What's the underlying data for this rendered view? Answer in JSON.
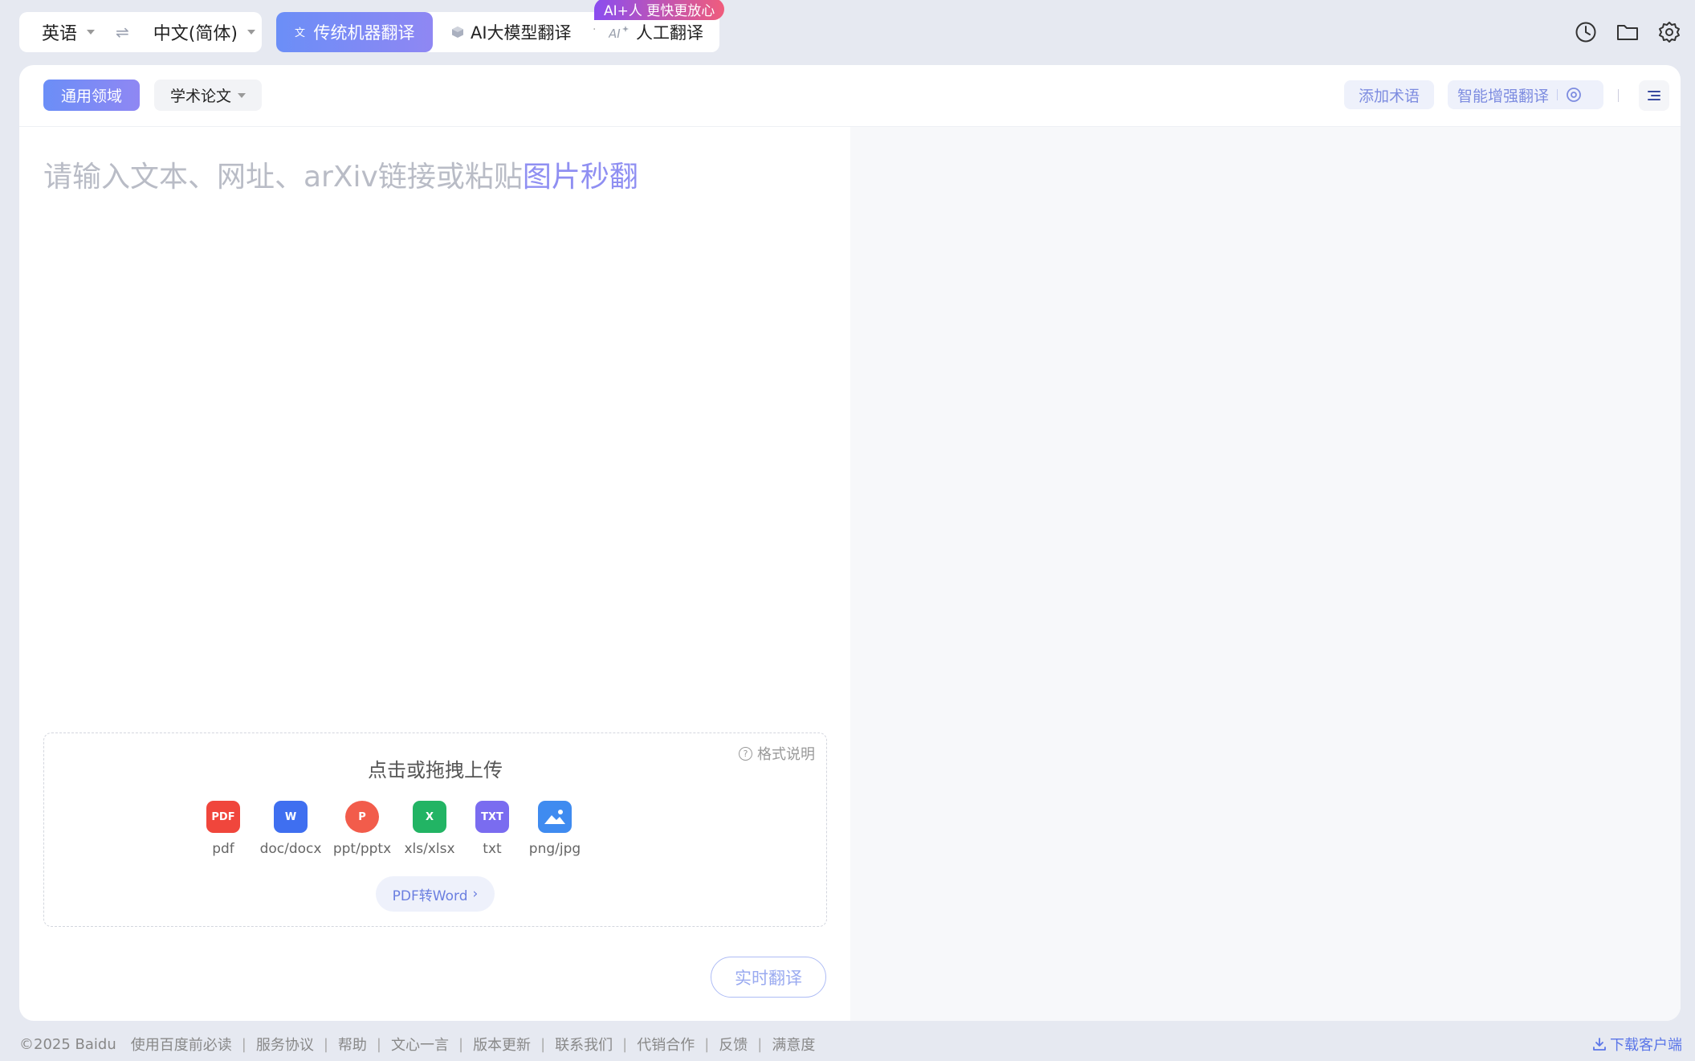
{
  "lang": {
    "source": "英语",
    "target": "中文(简体)",
    "swap_icon": "swap-icon"
  },
  "modes": {
    "traditional": "传统机器翻译",
    "ai_model": "AI大模型翻译",
    "human": "人工翻译",
    "badge": "AI+人 更快更放心"
  },
  "domains": {
    "general": "通用领域",
    "academic": "学术论文"
  },
  "tools": {
    "add_term": "添加术语",
    "enhance": "智能增强翻译"
  },
  "input": {
    "placeholder_text": "请输入文本、网址、arXiv链接或粘贴",
    "placeholder_link": "图片秒翻"
  },
  "upload": {
    "title": "点击或拖拽上传",
    "format_help": "格式说明",
    "types": [
      {
        "label": "pdf",
        "color": "#f0463c"
      },
      {
        "label": "doc/docx",
        "color": "#3f6ff0"
      },
      {
        "label": "ppt/pptx",
        "color": "#f25c4b"
      },
      {
        "label": "xls/xlsx",
        "color": "#22b464"
      },
      {
        "label": "txt",
        "color": "#7a6cf0"
      },
      {
        "label": "png/jpg",
        "color": "#3f8bf0"
      }
    ],
    "pdf_to_word": "PDF转Word"
  },
  "realtime_button": "实时翻译",
  "footer": {
    "copyright": "©2025 Baidu",
    "links": [
      "使用百度前必读",
      "服务协议",
      "帮助",
      "文心一言",
      "版本更新",
      "联系我们",
      "代销合作",
      "反馈",
      "满意度"
    ],
    "download": "下载客户端"
  }
}
